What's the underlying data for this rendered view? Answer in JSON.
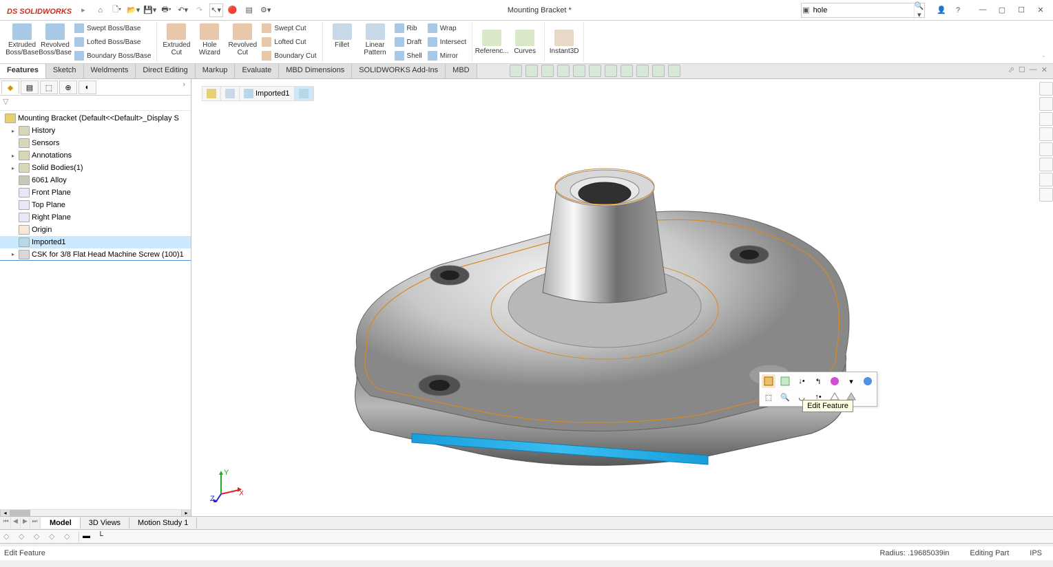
{
  "app": {
    "name": "SOLIDWORKS",
    "doc_title": "Mounting Bracket *"
  },
  "search": {
    "value": "hole"
  },
  "ribbon": {
    "extruded_boss": "Extruded Boss/Base",
    "revolved_boss": "Revolved Boss/Base",
    "swept_boss": "Swept Boss/Base",
    "lofted_boss": "Lofted Boss/Base",
    "boundary_boss": "Boundary Boss/Base",
    "extruded_cut": "Extruded Cut",
    "hole_wizard": "Hole Wizard",
    "revolved_cut": "Revolved Cut",
    "swept_cut": "Swept Cut",
    "lofted_cut": "Lofted Cut",
    "boundary_cut": "Boundary Cut",
    "fillet": "Fillet",
    "linear_pattern": "Linear Pattern",
    "rib": "Rib",
    "draft": "Draft",
    "shell": "Shell",
    "wrap": "Wrap",
    "intersect": "Intersect",
    "mirror": "Mirror",
    "reference": "Referenc...",
    "curves": "Curves",
    "instant3d": "Instant3D"
  },
  "tabs": {
    "features": "Features",
    "sketch": "Sketch",
    "weldments": "Weldments",
    "direct_editing": "Direct Editing",
    "markup": "Markup",
    "evaluate": "Evaluate",
    "mbd_dimensions": "MBD Dimensions",
    "addins": "SOLIDWORKS Add-Ins",
    "mbd": "MBD"
  },
  "tree": {
    "root": "Mounting Bracket  (Default<<Default>_Display S",
    "history": "History",
    "sensors": "Sensors",
    "annotations": "Annotations",
    "solid_bodies": "Solid Bodies(1)",
    "material": "6061 Alloy",
    "front_plane": "Front Plane",
    "top_plane": "Top Plane",
    "right_plane": "Right Plane",
    "origin": "Origin",
    "imported1": "Imported1",
    "csk": "CSK for 3/8 Flat Head Machine Screw (100)1"
  },
  "breadcrumb": {
    "imported1": "Imported1"
  },
  "tooltip": {
    "edit_feature": "Edit Feature"
  },
  "view_tabs": {
    "model": "Model",
    "views3d": "3D Views",
    "motion_study": "Motion Study 1"
  },
  "statusbar": {
    "left": "Edit Feature",
    "radius": "Radius: .19685039in",
    "mode": "Editing Part",
    "units": "IPS"
  }
}
